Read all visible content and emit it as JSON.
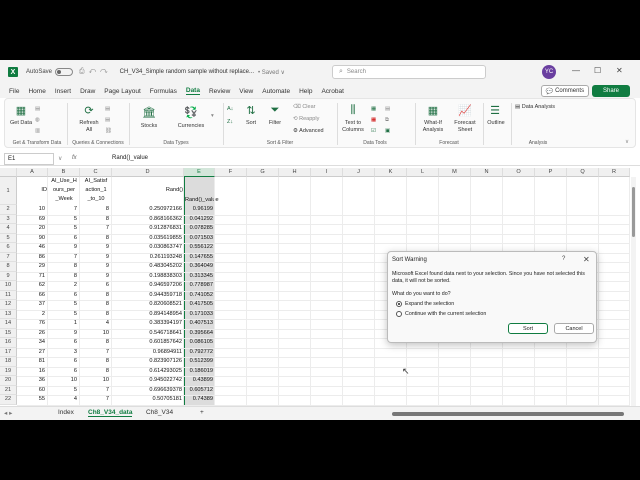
{
  "titlebar": {
    "logo": "X",
    "autosave": "AutoSave",
    "toggle_state": "Off",
    "doc_title": "CH_V34_Simple random sample without replace...",
    "saved": "• Saved ∨",
    "search_placeholder": "Search",
    "user_initials": "YC",
    "minimize": "—",
    "maximize": "☐",
    "close": "✕"
  },
  "menu": {
    "items": [
      "File",
      "Home",
      "Insert",
      "Draw",
      "Page Layout",
      "Formulas",
      "Data",
      "Review",
      "View",
      "Automate",
      "Help",
      "Acrobat"
    ],
    "active": "Data",
    "comments": "Comments",
    "share": "Share"
  },
  "ribbon": {
    "get_data": "Get Data",
    "refresh_all": "Refresh All",
    "stocks": "Stocks",
    "currencies": "Currencies",
    "sort": "Sort",
    "filter": "Filter",
    "clear": "Clear",
    "reapply": "Reapply",
    "advanced": "Advanced",
    "text_to_columns": "Text to Columns",
    "what_if": "What-If Analysis",
    "forecast_sheet": "Forecast Sheet",
    "outline": "Outline",
    "data_analysis": "Data Analysis",
    "groups": {
      "get_transform": "Get & Transform Data",
      "queries": "Queries & Connections",
      "data_types": "Data Types",
      "sort_filter": "Sort & Filter",
      "data_tools": "Data Tools",
      "forecast": "Forecast",
      "analysis": "Analysis"
    }
  },
  "formula_bar": {
    "cell_ref": "E1",
    "fx": "fx",
    "value": "Rand()_value"
  },
  "grid": {
    "columns": [
      "A",
      "B",
      "C",
      "D",
      "E",
      "F",
      "G",
      "H",
      "I",
      "J",
      "K",
      "L",
      "M",
      "N",
      "O",
      "P",
      "Q",
      "R"
    ],
    "selected_column": "E",
    "header_row": {
      "A": "ID",
      "B_lines": [
        "AI_Use_H",
        "ours_per",
        "_Week"
      ],
      "C_lines": [
        "AI_Satisf",
        "action_1",
        "_to_10"
      ],
      "D": "Rand()",
      "E": "Rand()_value"
    },
    "rows": [
      {
        "n": "2",
        "a": "10",
        "b": "7",
        "c": "8",
        "d": "0.250972166",
        "e": "0.96199"
      },
      {
        "n": "3",
        "a": "69",
        "b": "5",
        "c": "8",
        "d": "0.868166362",
        "e": "0.041292"
      },
      {
        "n": "4",
        "a": "20",
        "b": "5",
        "c": "7",
        "d": "0.912876831",
        "e": "0.078285"
      },
      {
        "n": "5",
        "a": "90",
        "b": "6",
        "c": "8",
        "d": "0.035619855",
        "e": "0.071503"
      },
      {
        "n": "6",
        "a": "46",
        "b": "9",
        "c": "9",
        "d": "0.030863747",
        "e": "0.556122"
      },
      {
        "n": "7",
        "a": "86",
        "b": "7",
        "c": "9",
        "d": "0.261193248",
        "e": "0.147655"
      },
      {
        "n": "8",
        "a": "29",
        "b": "8",
        "c": "9",
        "d": "0.483045202",
        "e": "0.364049"
      },
      {
        "n": "9",
        "a": "71",
        "b": "8",
        "c": "9",
        "d": "0.198838303",
        "e": "0.313345"
      },
      {
        "n": "10",
        "a": "62",
        "b": "2",
        "c": "6",
        "d": "0.946597206",
        "e": "0.778987"
      },
      {
        "n": "11",
        "a": "66",
        "b": "6",
        "c": "8",
        "d": "0.944359718",
        "e": "0.741052"
      },
      {
        "n": "12",
        "a": "37",
        "b": "5",
        "c": "8",
        "d": "0.820608521",
        "e": "0.417505"
      },
      {
        "n": "13",
        "a": "2",
        "b": "5",
        "c": "8",
        "d": "0.894148954",
        "e": "0.171033"
      },
      {
        "n": "14",
        "a": "76",
        "b": "1",
        "c": "4",
        "d": "0.383394197",
        "e": "0.407513"
      },
      {
        "n": "15",
        "a": "26",
        "b": "9",
        "c": "10",
        "d": "0.546718641",
        "e": "0.395664"
      },
      {
        "n": "16",
        "a": "34",
        "b": "6",
        "c": "8",
        "d": "0.601857642",
        "e": "0.086105"
      },
      {
        "n": "17",
        "a": "27",
        "b": "3",
        "c": "7",
        "d": "0.96894911",
        "e": "0.792772"
      },
      {
        "n": "18",
        "a": "81",
        "b": "6",
        "c": "8",
        "d": "0.823907126",
        "e": "0.512399"
      },
      {
        "n": "19",
        "a": "16",
        "b": "6",
        "c": "8",
        "d": "0.614293025",
        "e": "0.186019"
      },
      {
        "n": "20",
        "a": "36",
        "b": "10",
        "c": "10",
        "d": "0.945022742",
        "e": "0.43899"
      },
      {
        "n": "21",
        "a": "60",
        "b": "5",
        "c": "7",
        "d": "0.696639378",
        "e": "0.605712"
      },
      {
        "n": "22",
        "a": "55",
        "b": "4",
        "c": "7",
        "d": "0.50705181",
        "e": "0.74389"
      }
    ]
  },
  "sheets": {
    "tabs": [
      "Index",
      "Ch8_V34_data",
      "Ch8_V34"
    ],
    "active": "Ch8_V34_data",
    "add": "+"
  },
  "dialog": {
    "title": "Sort Warning",
    "help": "?",
    "close": "✕",
    "message": "Microsoft Excel found data next to your selection. Since you have not selected this data, it will not be sorted.",
    "question": "What do you want to do?",
    "option_expand": "Expand the selection",
    "option_continue": "Continue with the current selection",
    "selected_option": "expand",
    "sort_button": "Sort",
    "cancel_button": "Cancel"
  }
}
